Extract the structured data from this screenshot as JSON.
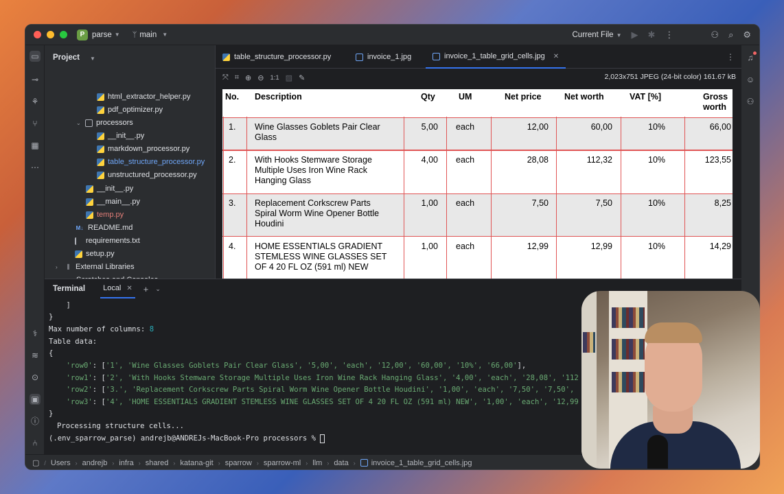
{
  "titlebar": {
    "project_badge": "P",
    "project_name": "parse",
    "branch": "main",
    "run_config": "Current File"
  },
  "project_panel": {
    "title": "Project",
    "tree": [
      {
        "name": "html_extractor_helper.py",
        "type": "py"
      },
      {
        "name": "pdf_optimizer.py",
        "type": "py"
      },
      {
        "name": "processors",
        "type": "dir"
      },
      {
        "name": "__init__.py",
        "type": "py"
      },
      {
        "name": "markdown_processor.py",
        "type": "py"
      },
      {
        "name": "table_structure_processor.py",
        "type": "py",
        "selected": true
      },
      {
        "name": "unstructured_processor.py",
        "type": "py"
      },
      {
        "name": "__init__.py",
        "type": "py"
      },
      {
        "name": "__main__.py",
        "type": "py"
      },
      {
        "name": "temp.py",
        "type": "py"
      },
      {
        "name": "README.md",
        "type": "md"
      },
      {
        "name": "requirements.txt",
        "type": "txt"
      },
      {
        "name": "setup.py",
        "type": "py"
      },
      {
        "name": "External Libraries",
        "type": "lib"
      },
      {
        "name": "Scratches and Consoles",
        "type": "scratch"
      }
    ]
  },
  "editor": {
    "tabs": [
      {
        "label": "table_structure_processor.py"
      },
      {
        "label": "invoice_1.jpg"
      },
      {
        "label": "invoice_1_table_grid_cells.jpg",
        "active": true
      }
    ],
    "zoom_label": "1:1",
    "image_info": "2,023x751 JPEG (24-bit color) 161.67 kB"
  },
  "invoice": {
    "headers": [
      "No.",
      "Description",
      "Qty",
      "UM",
      "Net price",
      "Net worth",
      "VAT [%]",
      "Gross",
      "worth"
    ],
    "rows": [
      {
        "no": "1.",
        "desc1": "Wine Glasses Goblets Pair Clear",
        "desc2": "Glass",
        "desc3": "",
        "qty": "5,00",
        "um": "each",
        "price": "12,00",
        "worth": "60,00",
        "vat": "10%",
        "gross": "66,00"
      },
      {
        "no": "2.",
        "desc1": "With Hooks Stemware Storage",
        "desc2": "Multiple Uses Iron Wine Rack",
        "desc3": "Hanging Glass",
        "qty": "4,00",
        "um": "each",
        "price": "28,08",
        "worth": "112,32",
        "vat": "10%",
        "gross": "123,55"
      },
      {
        "no": "3.",
        "desc1": "Replacement Corkscrew Parts",
        "desc2": "Spiral Worm Wine Opener Bottle",
        "desc3": "Houdini",
        "qty": "1,00",
        "um": "each",
        "price": "7,50",
        "worth": "7,50",
        "vat": "10%",
        "gross": "8,25"
      },
      {
        "no": "4.",
        "desc1": "HOME ESSENTIALS GRADIENT",
        "desc2": "STEMLESS WINE GLASSES SET",
        "desc3": "OF 4 20 FL OZ (591 ml) NEW",
        "qty": "1,00",
        "um": "each",
        "price": "12,99",
        "worth": "12,99",
        "vat": "10%",
        "gross": "14,29"
      }
    ]
  },
  "terminal": {
    "title": "Terminal",
    "tab": "Local",
    "lines": {
      "l0": "    ]",
      "l1": "}",
      "l2a": "Max number of columns: ",
      "l2b": "8",
      "l3": "Table data:",
      "l4": "{",
      "l5a": "    ",
      "l5b": "'row0'",
      "l5c": ": [",
      "l5d": "'1', 'Wine Glasses Goblets Pair Clear Glass', '5,00', 'each', '12,00', '60,00', '10%', '66,00'",
      "l5e": "],",
      "l6b": "'row1'",
      "l6d": "'2', 'With Hooks Stemware Storage Multiple Uses Iron Wine Rack Hanging Glass', '4,00', 'each', '28,08', '112",
      "l7b": "'row2'",
      "l7d": "'3.', 'Replacement Corkscrew Parts Spiral Worm Wine Opener Bottle Houdini', '1,00', 'each', '7,50', '7,50',",
      "l8b": "'row3'",
      "l8d": "'4', 'HOME ESSENTIALS GRADIENT STEMLESS WINE GLASSES SET OF 4 20 FL OZ (591 ml) NEW', '1,00', 'each', '12,99",
      "l9": "}",
      "l10": "Processing structure cells...",
      "l11": "(.env_sparrow_parse) andrejb@ANDREJs-MacBook-Pro processors % "
    }
  },
  "statusbar": {
    "crumbs": [
      "Users",
      "andrejb",
      "infra",
      "shared",
      "katana-git",
      "sparrow",
      "sparrow-ml",
      "llm",
      "data",
      "invoice_1_table_grid_cells.jpg"
    ]
  }
}
